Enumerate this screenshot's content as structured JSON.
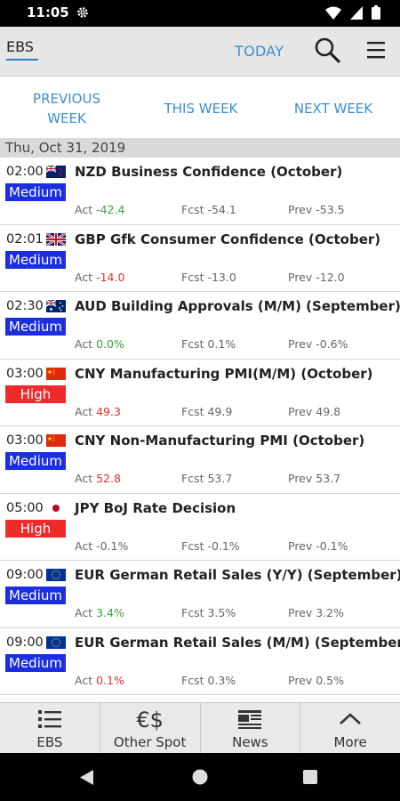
{
  "status_bar": {
    "time": "11:05"
  },
  "app_bar": {
    "title": "EBS",
    "today": "TODAY"
  },
  "week_tabs": [
    {
      "line1": "PREVIOUS",
      "line2": "WEEK"
    },
    {
      "line1": "THIS WEEK"
    },
    {
      "line1": "NEXT WEEK"
    }
  ],
  "date_header": "Thu, Oct 31, 2019",
  "events": [
    {
      "time": "02:00",
      "flag": "NZ",
      "impact": "Medium",
      "title": "NZD Business Confidence (October)",
      "act_label": "Act",
      "act": "-42.4",
      "act_dir": "pos",
      "fcst": "Fcst -54.1",
      "prev": "Prev -53.5"
    },
    {
      "time": "02:01",
      "flag": "GB",
      "impact": "Medium",
      "title": "GBP Gfk Consumer Confidence (October)",
      "act_label": "Act",
      "act": "-14.0",
      "act_dir": "neg",
      "fcst": "Fcst -13.0",
      "prev": "Prev -12.0"
    },
    {
      "time": "02:30",
      "flag": "AU",
      "impact": "Medium",
      "title": "AUD Building Approvals (M/M) (September)",
      "act_label": "Act",
      "act": "0.0%",
      "act_dir": "pos",
      "fcst": "Fcst 0.1%",
      "prev": "Prev -0.6%"
    },
    {
      "time": "03:00",
      "flag": "CN",
      "impact": "High",
      "title": "CNY Manufacturing PMI(M/M) (October)",
      "act_label": "Act",
      "act": "49.3",
      "act_dir": "neg",
      "fcst": "Fcst 49.9",
      "prev": "Prev 49.8"
    },
    {
      "time": "03:00",
      "flag": "CN",
      "impact": "Medium",
      "title": "CNY Non-Manufacturing PMI (October)",
      "act_label": "Act",
      "act": "52.8",
      "act_dir": "neg",
      "fcst": "Fcst 53.7",
      "prev": "Prev 53.7"
    },
    {
      "time": "05:00",
      "flag": "JP",
      "impact": "High",
      "title": "JPY BoJ Rate Decision",
      "act_label": "Act",
      "act": "-0.1%",
      "act_dir": "none",
      "fcst": "Fcst -0.1%",
      "prev": "Prev -0.1%"
    },
    {
      "time": "09:00",
      "flag": "EU",
      "impact": "Medium",
      "title": "EUR German Retail Sales (Y/Y) (September)",
      "act_label": "Act",
      "act": "3.4%",
      "act_dir": "pos",
      "fcst": "Fcst 3.5%",
      "prev": "Prev 3.2%"
    },
    {
      "time": "09:00",
      "flag": "EU",
      "impact": "Medium",
      "title": "EUR German Retail Sales (M/M) (September)",
      "act_label": "Act",
      "act": "0.1%",
      "act_dir": "neg",
      "fcst": "Fcst 0.3%",
      "prev": "Prev 0.5%"
    }
  ],
  "impact_colors": {
    "Medium": "#1c2fe0",
    "High": "#ee2a2a"
  },
  "bottom_nav": [
    {
      "label": "EBS",
      "icon": "list-icon"
    },
    {
      "label": "Other Spot",
      "icon": "euro-dollar-icon",
      "glyph": "€$"
    },
    {
      "label": "News",
      "icon": "newspaper-icon"
    },
    {
      "label": "More",
      "icon": "chevron-up-icon"
    }
  ]
}
